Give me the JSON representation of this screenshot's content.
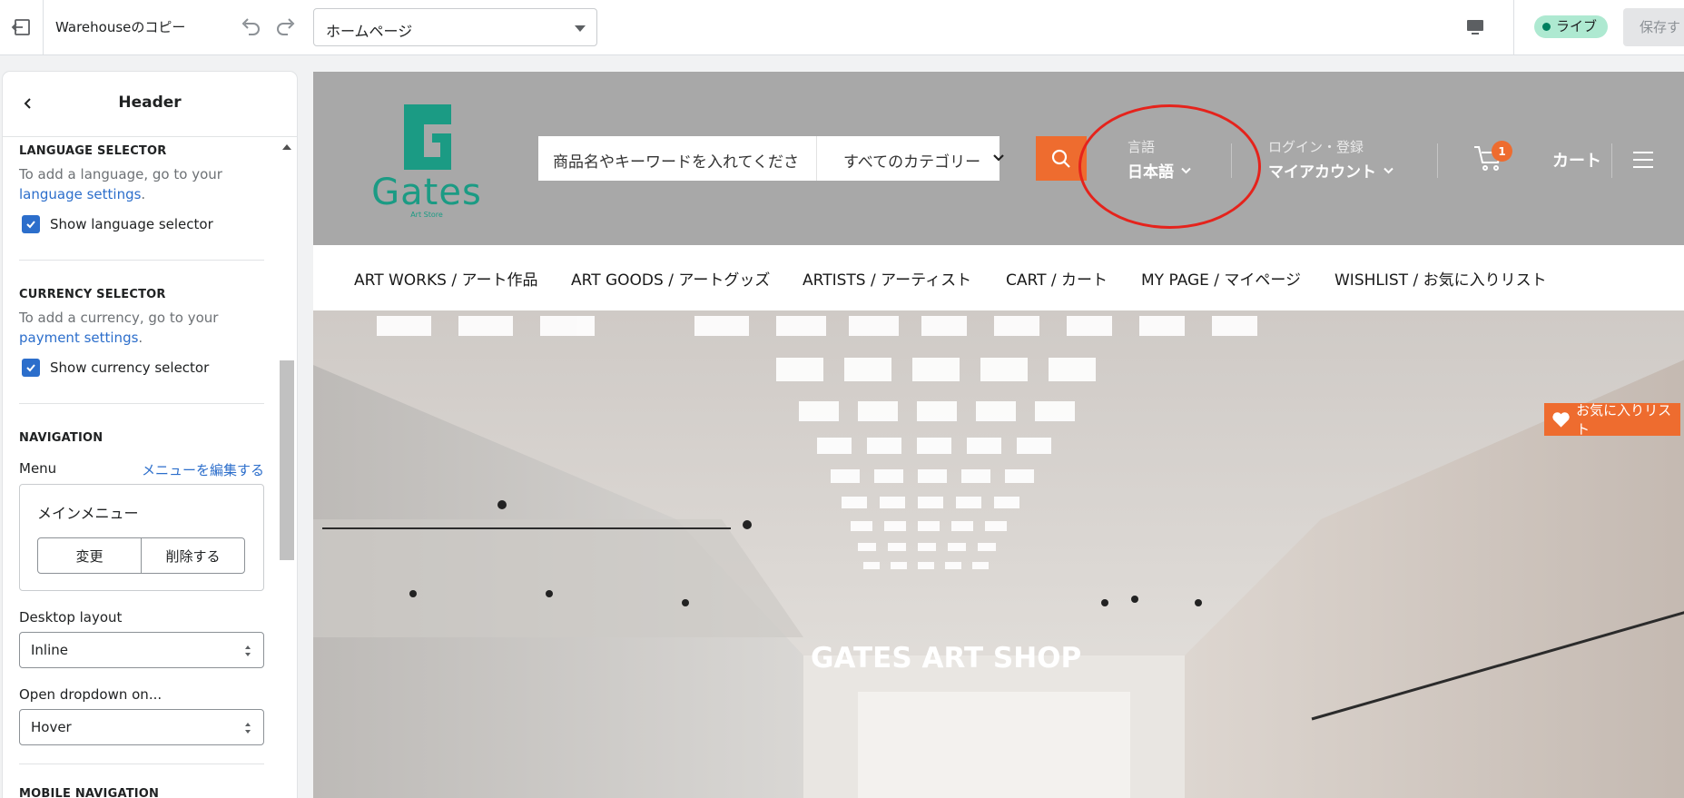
{
  "topbar": {
    "theme_name": "Warehouseのコピー",
    "page_select_value": "ホームページ",
    "live_label": "ライブ",
    "save_label": "保存す"
  },
  "sidebar": {
    "title": "Header",
    "language": {
      "section_title": "LANGUAGE SELECTOR",
      "help_prefix": "To add a language, go to your",
      "help_link": "language settings",
      "help_suffix": ".",
      "checkbox_label": "Show language selector"
    },
    "currency": {
      "section_title": "CURRENCY SELECTOR",
      "help_prefix": "To add a currency, go to your",
      "help_link": "payment settings",
      "help_suffix": ".",
      "checkbox_label": "Show currency selector"
    },
    "navigation": {
      "section_title": "NAVIGATION",
      "menu_label": "Menu",
      "edit_menu_link": "メニューを編集する",
      "menu_name": "メインメニュー",
      "change_button": "変更",
      "delete_button": "削除する",
      "desktop_layout_label": "Desktop layout",
      "desktop_layout_value": "Inline",
      "open_dropdown_label": "Open dropdown on...",
      "open_dropdown_value": "Hover"
    },
    "mobile_navigation_title": "MOBILE NAVIGATION"
  },
  "preview": {
    "logo_word": "Gates",
    "logo_sub": "Art Store",
    "search_placeholder": "商品名やキーワードを入れてください",
    "search_category": "すべてのカテゴリー",
    "language_small": "言語",
    "language_value": "日本語",
    "account_small": "ログイン・登録",
    "account_value": "マイアカウント",
    "cart_count": "1",
    "cart_label": "カート",
    "nav_items": [
      "ART WORKS / アート作品",
      "ART GOODS / アートグッズ",
      "ARTISTS / アーティスト",
      "CART / カート",
      "MY PAGE / マイページ",
      "WISHLIST / お気に入りリスト"
    ],
    "hero_title": "GATES ART SHOP",
    "wishlist_tab": "お気に入りリスト"
  },
  "colors": {
    "accent_orange": "#ee6c2f",
    "logo_green": "#1b9b84",
    "link_blue": "#2c6ecb",
    "annotation_red": "#e5231c"
  }
}
